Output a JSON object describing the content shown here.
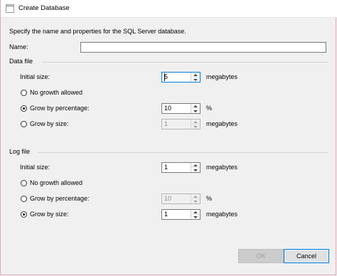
{
  "window": {
    "title": "Create Database",
    "icon": "database-icon"
  },
  "description": "Specify the name and properties for the SQL Server database.",
  "name_field": {
    "label": "Name:",
    "value": ""
  },
  "data_file": {
    "section_label": "Data file",
    "initial_size": {
      "label": "Initial size:",
      "value": "5",
      "unit": "megabytes"
    },
    "options": {
      "no_growth": "No growth allowed",
      "by_percentage": "Grow by percentage:",
      "by_size": "Grow by size:"
    },
    "selected": "by_percentage",
    "percentage": {
      "value": "10",
      "unit": "%",
      "enabled": true
    },
    "size": {
      "value": "1",
      "unit": "megabytes",
      "enabled": false
    }
  },
  "log_file": {
    "section_label": "Log file",
    "initial_size": {
      "label": "Initial size:",
      "value": "1",
      "unit": "megabytes"
    },
    "options": {
      "no_growth": "No growth allowed",
      "by_percentage": "Grow by percentage:",
      "by_size": "Grow by size:"
    },
    "selected": "by_size",
    "percentage": {
      "value": "10",
      "unit": "%",
      "enabled": false
    },
    "size": {
      "value": "1",
      "unit": "megabytes",
      "enabled": true
    }
  },
  "buttons": {
    "ok": "OK",
    "ok_enabled": false,
    "cancel": "Cancel"
  },
  "colors": {
    "window_border": "#e3a6ba",
    "focus_border": "#0078d7"
  }
}
